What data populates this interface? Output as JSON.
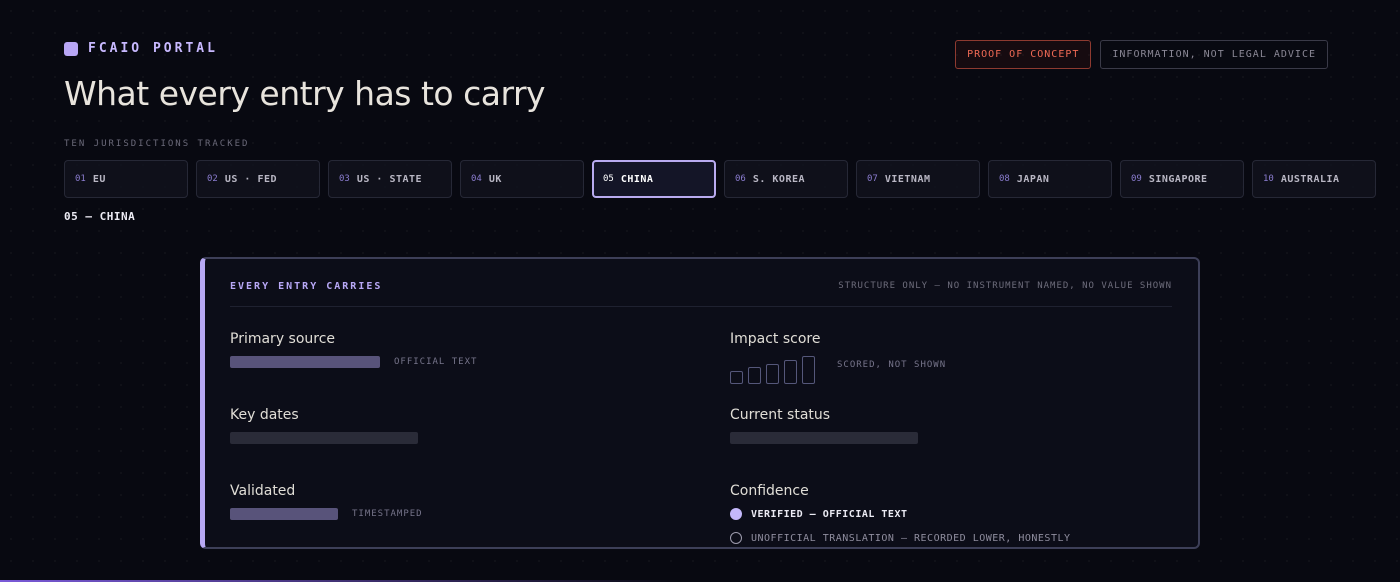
{
  "header": {
    "brand": "FCAIO PORTAL",
    "badge_poc": "PROOF OF CONCEPT",
    "badge_info": "INFORMATION, NOT LEGAL ADVICE",
    "title": "What every entry has to carry"
  },
  "jurisdictions": {
    "caption": "TEN JURISDICTIONS TRACKED",
    "tabs": [
      {
        "num": "01",
        "label": "EU"
      },
      {
        "num": "02",
        "label": "US · FED"
      },
      {
        "num": "03",
        "label": "US · STATE"
      },
      {
        "num": "04",
        "label": "UK"
      },
      {
        "num": "05",
        "label": "CHINA"
      },
      {
        "num": "06",
        "label": "S. KOREA"
      },
      {
        "num": "07",
        "label": "VIETNAM"
      },
      {
        "num": "08",
        "label": "JAPAN"
      },
      {
        "num": "09",
        "label": "SINGAPORE"
      },
      {
        "num": "10",
        "label": "AUSTRALIA"
      }
    ],
    "active_index": 4,
    "selected_heading": "05 — CHINA"
  },
  "card": {
    "title": "EVERY ENTRY CARRIES",
    "note": "STRUCTURE ONLY — NO INSTRUMENT NAMED, NO VALUE SHOWN",
    "fields": {
      "primary_source": {
        "label": "Primary source",
        "hint": "OFFICIAL TEXT"
      },
      "impact_score": {
        "label": "Impact score",
        "hint": "SCORED, NOT SHOWN"
      },
      "key_dates": {
        "label": "Key dates"
      },
      "current_status": {
        "label": "Current status"
      },
      "validated": {
        "label": "Validated",
        "hint": "TIMESTAMPED"
      },
      "confidence": {
        "label": "Confidence",
        "options": [
          {
            "label": "VERIFIED — OFFICIAL TEXT",
            "selected": true
          },
          {
            "label": "UNOFFICIAL TRANSLATION — RECORDED LOWER, HONESTLY",
            "selected": false
          }
        ]
      }
    }
  },
  "colors": {
    "accent": "#b8a6f5",
    "poc": "#f06a55",
    "background": "#080911"
  }
}
